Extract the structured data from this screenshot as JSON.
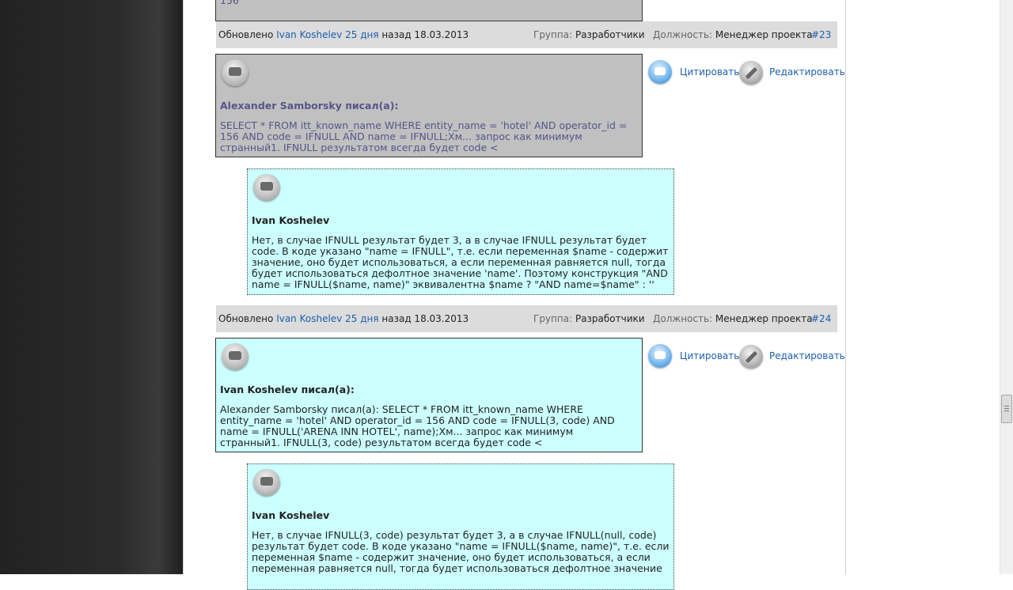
{
  "prev_fragment": "156",
  "posts": [
    {
      "meta": {
        "updated_label": "Обновлено",
        "user": "Ivan Koshelev",
        "ago": "25 дня",
        "ago_suffix": "назад 18.03.2013",
        "group_label": "Группа:",
        "group": "Разработчики",
        "role_label": "Должность:",
        "role": "Менеджер проекта",
        "number": "#23"
      },
      "quote_outer_author": "Alexander Samborsky писал(а):",
      "quote_outer_text": "SELECT * FROM itt_known_name WHERE entity_name = 'hotel' AND operator_id = 156 AND code = IFNULL AND name = IFNULL;Хм... запрос как минимум странный1. IFNULL результатом всегда будет code <",
      "quote_inner_author": "Ivan Koshelev",
      "quote_inner_text": "Нет, в случае IFNULL результат будет 3, а в случае IFNULL результат будет code. В коде указано \"name = IFNULL\", т.е. если переменная $name - содержит значение, оно будет использоваться, а если переменная равняется null, тогда будет использоваться дефолтное значение 'name'. Поэтому конструкция \"AND name = IFNULL($name, name)\" эквивалентна $name ? \"AND name=$name\" : ''",
      "actions": {
        "quote": "Цитировать",
        "edit": "Редактировать"
      }
    },
    {
      "meta": {
        "updated_label": "Обновлено",
        "user": "Ivan Koshelev",
        "ago": "25 дня",
        "ago_suffix": "назад 18.03.2013",
        "group_label": "Группа:",
        "group": "Разработчики",
        "role_label": "Должность:",
        "role": "Менеджер проекта",
        "number": "#24"
      },
      "quote_outer_author": "Ivan Koshelev писал(а):",
      "quote_outer_text": "Alexander Samborsky писал(а): SELECT * FROM itt_known_name WHERE entity_name = 'hotel' AND operator_id = 156 AND code = IFNULL(3, code) AND name = IFNULL('ARENA INN HOTEL', name);Хм... запрос как минимум странный1. IFNULL(3, code) результатом всегда будет code <",
      "quote_inner_author": "Ivan Koshelev",
      "quote_inner_text": "Нет, в случае IFNULL(3, code) результат будет 3, а в случае IFNULL(null, code) результат будет code. В коде указано \"name = IFNULL($name, name)\", т.е. если переменная $name - содержит значение, оно будет использоваться, а если переменная равняется null, тогда будет использоваться дефолтное значение",
      "actions": {
        "quote": "Цитировать",
        "edit": "Редактировать"
      }
    }
  ]
}
